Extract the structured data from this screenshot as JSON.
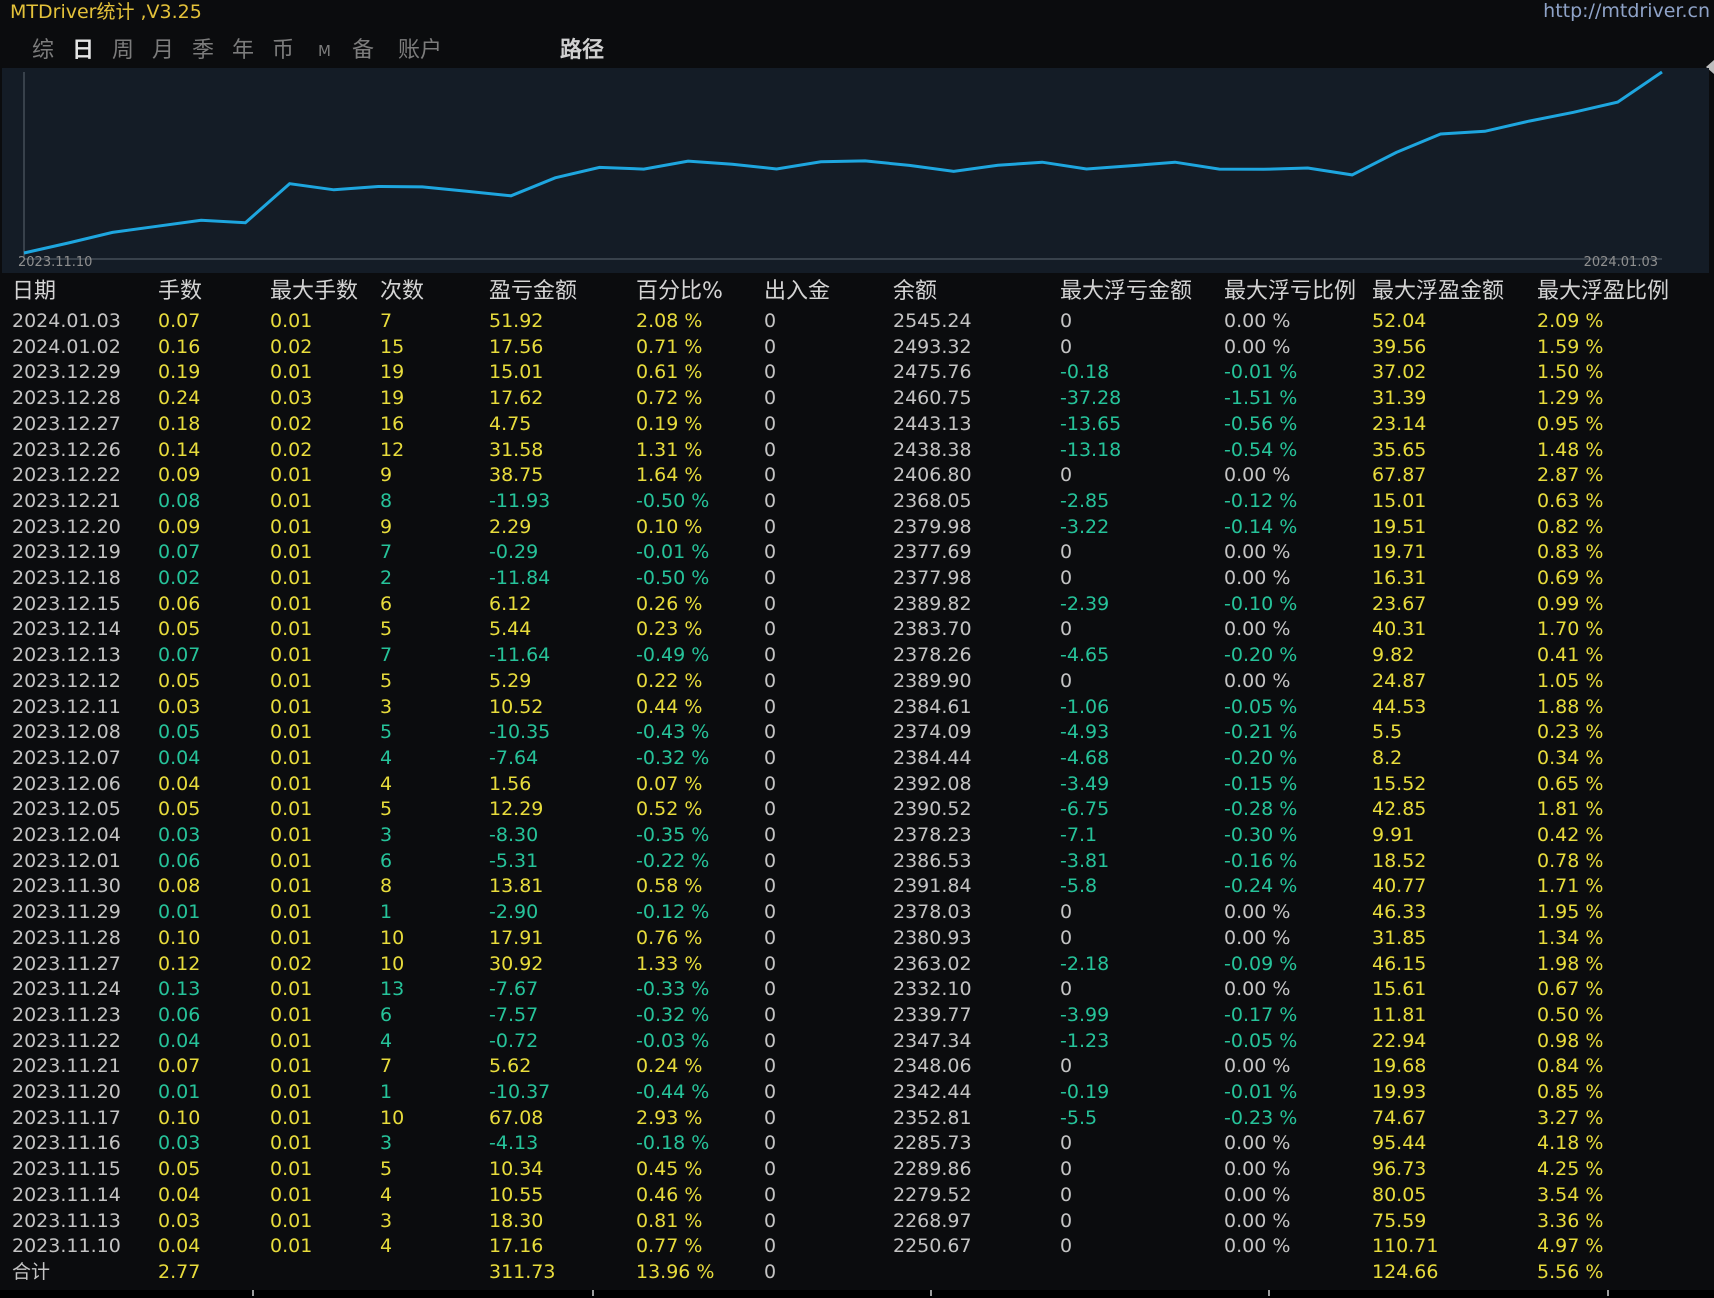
{
  "app": {
    "title": "MTDriver统计 ,V3.25",
    "site_link": "http://mtdriver.cn"
  },
  "tabs": [
    {
      "label": "综",
      "active": false
    },
    {
      "label": "日",
      "active": true
    },
    {
      "label": "周",
      "active": false
    },
    {
      "label": "月",
      "active": false
    },
    {
      "label": "季",
      "active": false
    },
    {
      "label": "年",
      "active": false
    },
    {
      "label": "币",
      "active": false
    },
    {
      "label": "M",
      "active": false
    },
    {
      "label": "备",
      "active": false
    },
    {
      "label": "账户",
      "active": false
    }
  ],
  "path_tab": "路径",
  "chart_range": {
    "start": "2023.11.10",
    "end": "2024.01.03"
  },
  "columns": [
    "日期",
    "手数",
    "最大手数",
    "次数",
    "盈亏金额",
    "百分比%",
    "出入金",
    "余额",
    "最大浮亏金额",
    "最大浮亏比例",
    "最大浮盈金额",
    "最大浮盈比例"
  ],
  "rows": [
    [
      "2024.01.03",
      "0.07",
      "0.01",
      "7",
      "51.92",
      "2.08 %",
      "0",
      "2545.24",
      "0",
      "0.00 %",
      "52.04",
      "2.09 %"
    ],
    [
      "2024.01.02",
      "0.16",
      "0.02",
      "15",
      "17.56",
      "0.71 %",
      "0",
      "2493.32",
      "0",
      "0.00 %",
      "39.56",
      "1.59 %"
    ],
    [
      "2023.12.29",
      "0.19",
      "0.01",
      "19",
      "15.01",
      "0.61 %",
      "0",
      "2475.76",
      "-0.18",
      "-0.01 %",
      "37.02",
      "1.50 %"
    ],
    [
      "2023.12.28",
      "0.24",
      "0.03",
      "19",
      "17.62",
      "0.72 %",
      "0",
      "2460.75",
      "-37.28",
      "-1.51 %",
      "31.39",
      "1.29 %"
    ],
    [
      "2023.12.27",
      "0.18",
      "0.02",
      "16",
      "4.75",
      "0.19 %",
      "0",
      "2443.13",
      "-13.65",
      "-0.56 %",
      "23.14",
      "0.95 %"
    ],
    [
      "2023.12.26",
      "0.14",
      "0.02",
      "12",
      "31.58",
      "1.31 %",
      "0",
      "2438.38",
      "-13.18",
      "-0.54 %",
      "35.65",
      "1.48 %"
    ],
    [
      "2023.12.22",
      "0.09",
      "0.01",
      "9",
      "38.75",
      "1.64 %",
      "0",
      "2406.80",
      "0",
      "0.00 %",
      "67.87",
      "2.87 %"
    ],
    [
      "2023.12.21",
      "0.08",
      "0.01",
      "8",
      "-11.93",
      "-0.50 %",
      "0",
      "2368.05",
      "-2.85",
      "-0.12 %",
      "15.01",
      "0.63 %"
    ],
    [
      "2023.12.20",
      "0.09",
      "0.01",
      "9",
      "2.29",
      "0.10 %",
      "0",
      "2379.98",
      "-3.22",
      "-0.14 %",
      "19.51",
      "0.82 %"
    ],
    [
      "2023.12.19",
      "0.07",
      "0.01",
      "7",
      "-0.29",
      "-0.01 %",
      "0",
      "2377.69",
      "0",
      "0.00 %",
      "19.71",
      "0.83 %"
    ],
    [
      "2023.12.18",
      "0.02",
      "0.01",
      "2",
      "-11.84",
      "-0.50 %",
      "0",
      "2377.98",
      "0",
      "0.00 %",
      "16.31",
      "0.69 %"
    ],
    [
      "2023.12.15",
      "0.06",
      "0.01",
      "6",
      "6.12",
      "0.26 %",
      "0",
      "2389.82",
      "-2.39",
      "-0.10 %",
      "23.67",
      "0.99 %"
    ],
    [
      "2023.12.14",
      "0.05",
      "0.01",
      "5",
      "5.44",
      "0.23 %",
      "0",
      "2383.70",
      "0",
      "0.00 %",
      "40.31",
      "1.70 %"
    ],
    [
      "2023.12.13",
      "0.07",
      "0.01",
      "7",
      "-11.64",
      "-0.49 %",
      "0",
      "2378.26",
      "-4.65",
      "-0.20 %",
      "9.82",
      "0.41 %"
    ],
    [
      "2023.12.12",
      "0.05",
      "0.01",
      "5",
      "5.29",
      "0.22 %",
      "0",
      "2389.90",
      "0",
      "0.00 %",
      "24.87",
      "1.05 %"
    ],
    [
      "2023.12.11",
      "0.03",
      "0.01",
      "3",
      "10.52",
      "0.44 %",
      "0",
      "2384.61",
      "-1.06",
      "-0.05 %",
      "44.53",
      "1.88 %"
    ],
    [
      "2023.12.08",
      "0.05",
      "0.01",
      "5",
      "-10.35",
      "-0.43 %",
      "0",
      "2374.09",
      "-4.93",
      "-0.21 %",
      "5.5",
      "0.23 %"
    ],
    [
      "2023.12.07",
      "0.04",
      "0.01",
      "4",
      "-7.64",
      "-0.32 %",
      "0",
      "2384.44",
      "-4.68",
      "-0.20 %",
      "8.2",
      "0.34 %"
    ],
    [
      "2023.12.06",
      "0.04",
      "0.01",
      "4",
      "1.56",
      "0.07 %",
      "0",
      "2392.08",
      "-3.49",
      "-0.15 %",
      "15.52",
      "0.65 %"
    ],
    [
      "2023.12.05",
      "0.05",
      "0.01",
      "5",
      "12.29",
      "0.52 %",
      "0",
      "2390.52",
      "-6.75",
      "-0.28 %",
      "42.85",
      "1.81 %"
    ],
    [
      "2023.12.04",
      "0.03",
      "0.01",
      "3",
      "-8.30",
      "-0.35 %",
      "0",
      "2378.23",
      "-7.1",
      "-0.30 %",
      "9.91",
      "0.42 %"
    ],
    [
      "2023.12.01",
      "0.06",
      "0.01",
      "6",
      "-5.31",
      "-0.22 %",
      "0",
      "2386.53",
      "-3.81",
      "-0.16 %",
      "18.52",
      "0.78 %"
    ],
    [
      "2023.11.30",
      "0.08",
      "0.01",
      "8",
      "13.81",
      "0.58 %",
      "0",
      "2391.84",
      "-5.8",
      "-0.24 %",
      "40.77",
      "1.71 %"
    ],
    [
      "2023.11.29",
      "0.01",
      "0.01",
      "1",
      "-2.90",
      "-0.12 %",
      "0",
      "2378.03",
      "0",
      "0.00 %",
      "46.33",
      "1.95 %"
    ],
    [
      "2023.11.28",
      "0.10",
      "0.01",
      "10",
      "17.91",
      "0.76 %",
      "0",
      "2380.93",
      "0",
      "0.00 %",
      "31.85",
      "1.34 %"
    ],
    [
      "2023.11.27",
      "0.12",
      "0.02",
      "10",
      "30.92",
      "1.33 %",
      "0",
      "2363.02",
      "-2.18",
      "-0.09 %",
      "46.15",
      "1.98 %"
    ],
    [
      "2023.11.24",
      "0.13",
      "0.01",
      "13",
      "-7.67",
      "-0.33 %",
      "0",
      "2332.10",
      "0",
      "0.00 %",
      "15.61",
      "0.67 %"
    ],
    [
      "2023.11.23",
      "0.06",
      "0.01",
      "6",
      "-7.57",
      "-0.32 %",
      "0",
      "2339.77",
      "-3.99",
      "-0.17 %",
      "11.81",
      "0.50 %"
    ],
    [
      "2023.11.22",
      "0.04",
      "0.01",
      "4",
      "-0.72",
      "-0.03 %",
      "0",
      "2347.34",
      "-1.23",
      "-0.05 %",
      "22.94",
      "0.98 %"
    ],
    [
      "2023.11.21",
      "0.07",
      "0.01",
      "7",
      "5.62",
      "0.24 %",
      "0",
      "2348.06",
      "0",
      "0.00 %",
      "19.68",
      "0.84 %"
    ],
    [
      "2023.11.20",
      "0.01",
      "0.01",
      "1",
      "-10.37",
      "-0.44 %",
      "0",
      "2342.44",
      "-0.19",
      "-0.01 %",
      "19.93",
      "0.85 %"
    ],
    [
      "2023.11.17",
      "0.10",
      "0.01",
      "10",
      "67.08",
      "2.93 %",
      "0",
      "2352.81",
      "-5.5",
      "-0.23 %",
      "74.67",
      "3.27 %"
    ],
    [
      "2023.11.16",
      "0.03",
      "0.01",
      "3",
      "-4.13",
      "-0.18 %",
      "0",
      "2285.73",
      "0",
      "0.00 %",
      "95.44",
      "4.18 %"
    ],
    [
      "2023.11.15",
      "0.05",
      "0.01",
      "5",
      "10.34",
      "0.45 %",
      "0",
      "2289.86",
      "0",
      "0.00 %",
      "96.73",
      "4.25 %"
    ],
    [
      "2023.11.14",
      "0.04",
      "0.01",
      "4",
      "10.55",
      "0.46 %",
      "0",
      "2279.52",
      "0",
      "0.00 %",
      "80.05",
      "3.54 %"
    ],
    [
      "2023.11.13",
      "0.03",
      "0.01",
      "3",
      "18.30",
      "0.81 %",
      "0",
      "2268.97",
      "0",
      "0.00 %",
      "75.59",
      "3.36 %"
    ],
    [
      "2023.11.10",
      "0.04",
      "0.01",
      "4",
      "17.16",
      "0.77 %",
      "0",
      "2250.67",
      "0",
      "0.00 %",
      "110.71",
      "4.97 %"
    ]
  ],
  "total": {
    "label": "合计",
    "lots": "2.77",
    "pnl": "311.73",
    "pct": "13.96 %",
    "inout": "0",
    "max_float_profit": "124.66",
    "max_float_profit_pct": "5.56 %"
  },
  "colors": {
    "line": "#1ea6df",
    "positive": "#e8dc3c",
    "negative": "#26c39a",
    "chart_bg": "#141c26",
    "page_bg": "#0b0c0e"
  }
}
